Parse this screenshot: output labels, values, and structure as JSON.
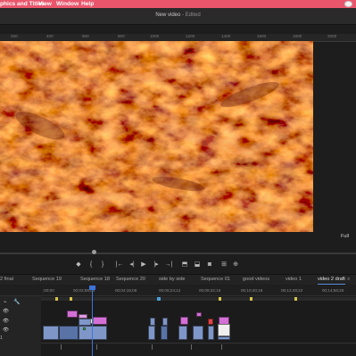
{
  "menubar": {
    "items": [
      "phics and Titles",
      "View",
      "Window",
      "Help"
    ]
  },
  "title": {
    "main": "New video",
    "sub": " - Edited"
  },
  "source_ruler": {
    "labels": [
      "250",
      "400",
      "600",
      "800",
      "1000",
      "1200",
      "1400",
      "1600",
      "1800",
      "2000"
    ]
  },
  "program": {
    "fit": "Full",
    "controls": [
      "marker-icon",
      "in-point-icon",
      "out-point-icon",
      "go-to-in-icon",
      "step-back-icon",
      "play-icon",
      "step-forward-icon",
      "go-to-out-icon",
      "lift-icon",
      "extract-icon",
      "export-frame-icon",
      "comparison-view-icon"
    ],
    "control_glyphs": [
      "◆",
      "{",
      "}",
      "|←",
      "◂|",
      "▶",
      "|▸",
      "→|",
      "⬒",
      "⬓",
      "◙",
      "⊞"
    ]
  },
  "sequence_tabs": [
    {
      "label": "2 final",
      "active": false
    },
    {
      "label": "Sequence 19",
      "active": false
    },
    {
      "label": "Sequence 18",
      "active": false
    },
    {
      "label": "Sequence 20",
      "active": false
    },
    {
      "label": "side by side",
      "active": false
    },
    {
      "label": "Sequence 01",
      "active": false
    },
    {
      "label": "good videos",
      "active": false
    },
    {
      "label": "video 1",
      "active": false
    },
    {
      "label": "video 2 draft",
      "active": true
    }
  ],
  "tab_close": "×",
  "tab_menu": "≡",
  "timecodes": [
    ";00;00",
    "00;02;08;04",
    "00;04;16;08",
    "00;06;24;12",
    "00;08;32;16",
    "00;10;40;18",
    "00;12;48;22",
    "00;14;56;26"
  ],
  "tracks": {
    "eye_glyph": "👁",
    "v1_label": "1"
  },
  "colors": {
    "menubar": "#e9566c",
    "playhead": "#3d74d9",
    "clip_blue": "#7f97c8",
    "clip_pink": "#d46fd6",
    "footage_orange": "#e0541a"
  }
}
